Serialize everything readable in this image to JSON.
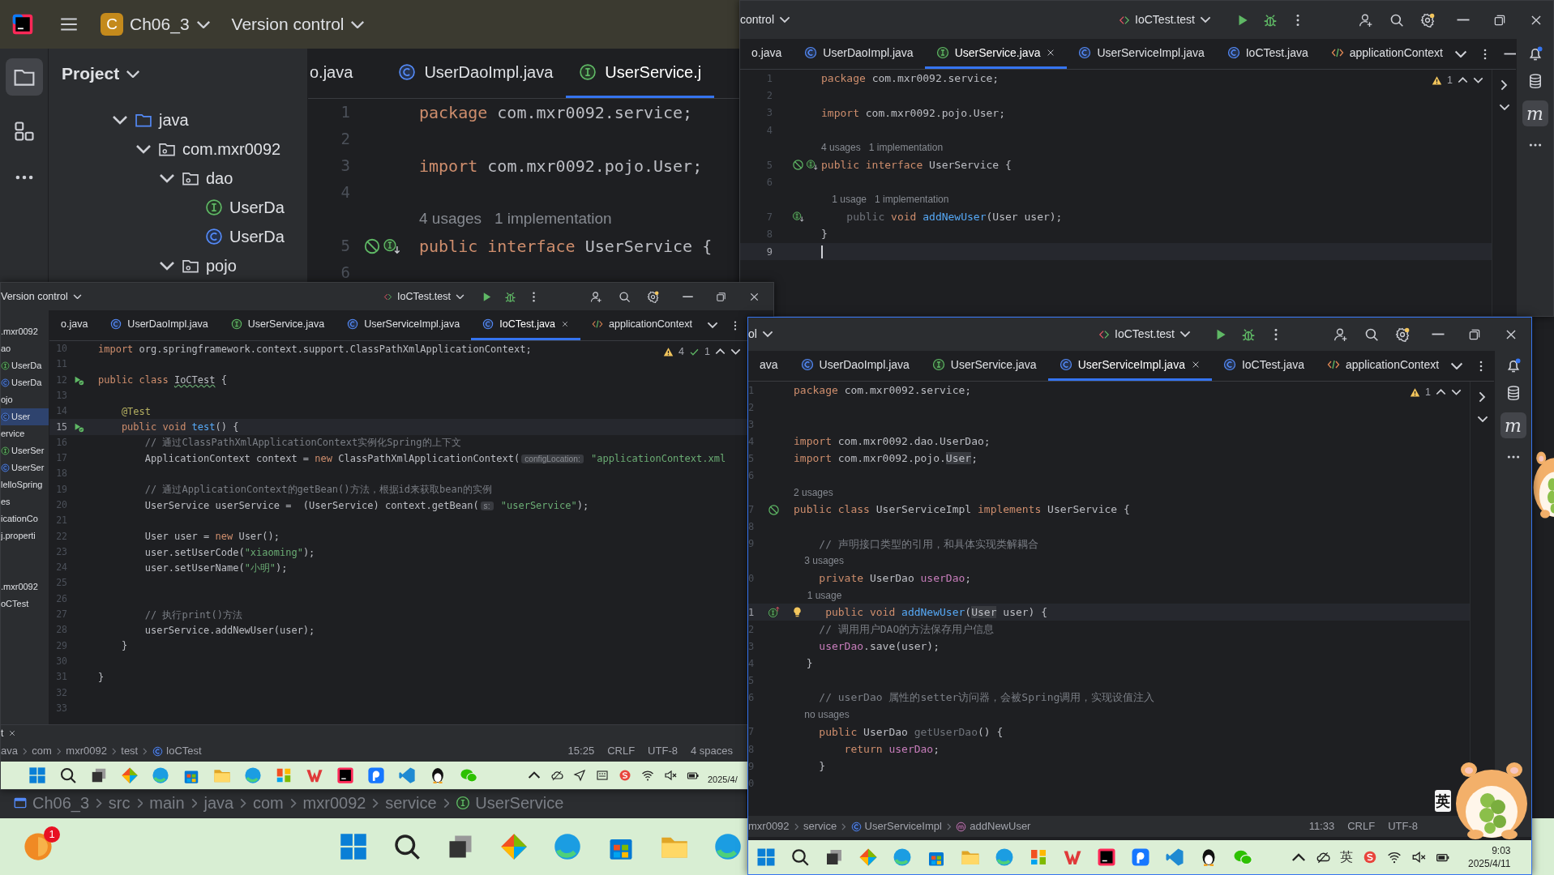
{
  "main_window": {
    "project_initial": "C",
    "project_name": "Ch06_3",
    "vcs": "Version control",
    "panel_title": "Project",
    "tree": [
      {
        "label": "java",
        "kind": "folder",
        "expanded": true,
        "children": [
          {
            "label": "com.mxr0092",
            "kind": "package",
            "expanded": true,
            "children": [
              {
                "label": "dao",
                "kind": "package",
                "expanded": true,
                "children": [
                  {
                    "label": "UserDa",
                    "kind": "interface"
                  },
                  {
                    "label": "UserDa",
                    "kind": "class"
                  }
                ]
              },
              {
                "label": "pojo",
                "kind": "package",
                "expanded": true
              }
            ]
          }
        ]
      }
    ],
    "tabs": [
      {
        "label": "o.java",
        "kind": "plain",
        "selected": false
      },
      {
        "label": "UserDaoImpl.java",
        "kind": "class",
        "selected": false
      },
      {
        "label": "UserService.j",
        "kind": "interface",
        "selected": true
      }
    ],
    "lines": [
      {
        "kind": "code",
        "number": "1",
        "current": false,
        "tokens": [
          {
            "kind": "keyword",
            "text": "package "
          },
          {
            "kind": "plain",
            "text": "com.mxr0092.service;"
          }
        ]
      },
      {
        "kind": "code",
        "number": "2",
        "current": false
      },
      {
        "kind": "code",
        "number": "3",
        "current": false,
        "tokens": [
          {
            "kind": "keyword",
            "text": "import "
          },
          {
            "kind": "plain",
            "text": "com.mxr0092.pojo.User;"
          }
        ]
      },
      {
        "kind": "code",
        "number": "4",
        "current": false
      },
      {
        "kind": "lens",
        "text": "4 usages   1 implementation"
      },
      {
        "kind": "code",
        "number": "5",
        "current": false,
        "tokens": [
          {
            "kind": "keyword",
            "text": "public interface "
          },
          {
            "kind": "plain",
            "text": "UserService {"
          }
        ]
      },
      {
        "kind": "code",
        "number": "6",
        "current": false
      }
    ],
    "breadcrumb": [
      {
        "label": "Ch06_3",
        "kind": "module"
      },
      {
        "label": "src",
        "kind": "plain"
      },
      {
        "label": "main",
        "kind": "plain"
      },
      {
        "label": "java",
        "kind": "plain"
      },
      {
        "label": "com",
        "kind": "plain"
      },
      {
        "label": "mxr0092",
        "kind": "plain"
      },
      {
        "label": "service",
        "kind": "plain"
      },
      {
        "label": "UserService",
        "kind": "interface"
      }
    ],
    "notification_count": "1"
  },
  "windows": [
    {
      "vcs": "control",
      "run_config": "IoCTest.test",
      "tabs": [
        {
          "label": "o.java",
          "kind": "plain",
          "selected": false
        },
        {
          "label": "UserDaoImpl.java",
          "kind": "class",
          "selected": false
        },
        {
          "label": "UserService.java",
          "kind": "interface",
          "selected": true
        },
        {
          "label": "UserServiceImpl.java",
          "kind": "class",
          "selected": false
        },
        {
          "label": "IoCTest.java",
          "kind": "class",
          "selected": false
        },
        {
          "label": "applicationContext",
          "kind": "xml",
          "selected": false
        }
      ],
      "inspection": {
        "warnings": "1"
      },
      "plugin_label": "m",
      "lines": [
        {
          "kind": "code",
          "number": "1",
          "current": false,
          "tokens": [
            {
              "kind": "keyword",
              "text": "package "
            },
            {
              "kind": "plain",
              "text": "com.mxr0092.service;"
            }
          ]
        },
        {
          "kind": "code",
          "number": "2",
          "current": false
        },
        {
          "kind": "code",
          "number": "3",
          "current": false,
          "tokens": [
            {
              "kind": "keyword",
              "text": "import "
            },
            {
              "kind": "plain",
              "text": "com.mxr0092.pojo.User;"
            }
          ]
        },
        {
          "kind": "code",
          "number": "4",
          "current": false
        },
        {
          "kind": "lens",
          "text": "4 usages   1 implementation"
        },
        {
          "kind": "code",
          "number": "5",
          "current": false,
          "tokens": [
            {
              "kind": "keyword",
              "text": "public interface "
            },
            {
              "kind": "plain",
              "text": "UserService {"
            }
          ]
        },
        {
          "kind": "code",
          "number": "6",
          "current": false
        },
        {
          "kind": "lens",
          "text": "    1 usage   1 implementation"
        },
        {
          "kind": "code",
          "number": "7",
          "current": false,
          "tokens": [
            {
              "kind": "muted",
              "text": "    public "
            },
            {
              "kind": "keyword",
              "text": "void "
            },
            {
              "kind": "method",
              "text": "addNewUser"
            },
            {
              "kind": "plain",
              "text": "(User user);"
            }
          ]
        },
        {
          "kind": "code",
          "number": "8",
          "current": false,
          "tokens": [
            {
              "kind": "plain",
              "text": "}"
            }
          ]
        },
        {
          "kind": "code",
          "number": "9",
          "current": true
        }
      ]
    },
    {
      "vcs": "Version control",
      "run_config": "IoCTest.test",
      "tabs": [
        {
          "label": "o.java",
          "kind": "plain",
          "selected": false
        },
        {
          "label": "UserDaoImpl.java",
          "kind": "class",
          "selected": false
        },
        {
          "label": "UserService.java",
          "kind": "interface",
          "selected": false
        },
        {
          "label": "UserServiceImpl.java",
          "kind": "class",
          "selected": false
        },
        {
          "label": "IoCTest.java",
          "kind": "class",
          "selected": true
        },
        {
          "label": "applicationContext",
          "kind": "xml",
          "selected": false
        }
      ],
      "inspection": {
        "warnings": "4",
        "checks": "1"
      },
      "project_groups": [
        [
          {
            "label": ".mxr0092",
            "kind": "plain",
            "selected": false
          },
          {
            "label": "ao",
            "kind": "plain",
            "selected": false
          },
          {
            "label": "UserDa",
            "kind": "interface",
            "selected": false
          },
          {
            "label": "UserDa",
            "kind": "class",
            "selected": false
          },
          {
            "label": "ojo",
            "kind": "plain",
            "selected": false
          },
          {
            "label": "User",
            "kind": "class",
            "selected": true
          },
          {
            "label": "ervice",
            "kind": "plain",
            "selected": false
          },
          {
            "label": "UserSer",
            "kind": "interface",
            "selected": false
          },
          {
            "label": "UserSer",
            "kind": "class",
            "selected": false
          },
          {
            "label": "lelloSpring",
            "kind": "plain",
            "selected": false
          },
          {
            "label": "es",
            "kind": "plain",
            "selected": false
          },
          {
            "label": "icationCo",
            "kind": "plain",
            "selected": false
          },
          {
            "label": "j.properti",
            "kind": "plain",
            "selected": false
          }
        ],
        [
          {
            "label": ".mxr0092",
            "kind": "plain",
            "selected": false
          },
          {
            "label": "oCTest",
            "kind": "plain",
            "selected": false
          }
        ]
      ],
      "lines": [
        {
          "kind": "code",
          "number": "10",
          "current": false,
          "tokens": [
            {
              "kind": "keyword",
              "text": "import "
            },
            {
              "kind": "plain",
              "text": "org.springframework.context.support.ClassPathXmlApplicationContext;"
            }
          ]
        },
        {
          "kind": "code",
          "number": "11",
          "current": false
        },
        {
          "kind": "code",
          "number": "12",
          "current": false,
          "tokens": [
            {
              "kind": "keyword",
              "text": "public class "
            },
            {
              "kind": "typo",
              "text": "IoCTest"
            },
            {
              "kind": "plain",
              "text": " {"
            }
          ]
        },
        {
          "kind": "code",
          "number": "13",
          "current": false
        },
        {
          "kind": "code",
          "number": "14",
          "current": false,
          "tokens": [
            {
              "kind": "annotation",
              "text": "    @Test"
            }
          ]
        },
        {
          "kind": "code",
          "number": "15",
          "current": true,
          "tokens": [
            {
              "kind": "keyword",
              "text": "    public void "
            },
            {
              "kind": "method",
              "text": "test"
            },
            {
              "kind": "plain",
              "text": "() {"
            }
          ]
        },
        {
          "kind": "code",
          "number": "16",
          "current": false,
          "tokens": [
            {
              "kind": "comment",
              "text": "        // 通过ClassPathXmlApplicationContext实例化Spring的上下文"
            }
          ]
        },
        {
          "kind": "code",
          "number": "17",
          "current": false,
          "tokens": [
            {
              "kind": "plain",
              "text": "        ApplicationContext context = "
            },
            {
              "kind": "keyword",
              "text": "new "
            },
            {
              "kind": "plain",
              "text": "ClassPathXmlApplicationContext("
            },
            {
              "kind": "hint",
              "text": "configLocation:"
            },
            {
              "kind": "string",
              "text": " \"applicationContext.xml"
            }
          ]
        },
        {
          "kind": "code",
          "number": "18",
          "current": false
        },
        {
          "kind": "code",
          "number": "19",
          "current": false,
          "tokens": [
            {
              "kind": "comment",
              "text": "        // 通过ApplicationContext的getBean()方法，根据id来获取bean的实例"
            }
          ]
        },
        {
          "kind": "code",
          "number": "20",
          "current": false,
          "tokens": [
            {
              "kind": "plain",
              "text": "        UserService userService =  (UserService) context.getBean("
            },
            {
              "kind": "hint",
              "text": "s:"
            },
            {
              "kind": "string",
              "text": " \"userService\""
            },
            {
              "kind": "plain",
              "text": ");"
            }
          ]
        },
        {
          "kind": "code",
          "number": "21",
          "current": false
        },
        {
          "kind": "code",
          "number": "22",
          "current": false,
          "tokens": [
            {
              "kind": "plain",
              "text": "        User user = "
            },
            {
              "kind": "keyword",
              "text": "new "
            },
            {
              "kind": "plain",
              "text": "User();"
            }
          ]
        },
        {
          "kind": "code",
          "number": "23",
          "current": false,
          "tokens": [
            {
              "kind": "plain",
              "text": "        user.setUserCode("
            },
            {
              "kind": "string",
              "text": "\"xiaoming\""
            },
            {
              "kind": "plain",
              "text": ");"
            }
          ]
        },
        {
          "kind": "code",
          "number": "24",
          "current": false,
          "tokens": [
            {
              "kind": "plain",
              "text": "        user.setUserName("
            },
            {
              "kind": "string",
              "text": "\"小明\""
            },
            {
              "kind": "plain",
              "text": ");"
            }
          ]
        },
        {
          "kind": "code",
          "number": "25",
          "current": false
        },
        {
          "kind": "code",
          "number": "26",
          "current": false
        },
        {
          "kind": "code",
          "number": "27",
          "current": false,
          "tokens": [
            {
              "kind": "comment",
              "text": "        // 执行print()方法"
            }
          ]
        },
        {
          "kind": "code",
          "number": "28",
          "current": false,
          "tokens": [
            {
              "kind": "plain",
              "text": "        userService.addNewUser(user);"
            }
          ]
        },
        {
          "kind": "code",
          "number": "29",
          "current": false,
          "tokens": [
            {
              "kind": "plain",
              "text": "    }"
            }
          ]
        },
        {
          "kind": "code",
          "number": "30",
          "current": false
        },
        {
          "kind": "code",
          "number": "31",
          "current": false,
          "tokens": [
            {
              "kind": "plain",
              "text": "}"
            }
          ]
        },
        {
          "kind": "code",
          "number": "32",
          "current": false
        },
        {
          "kind": "code",
          "number": "33",
          "current": false
        }
      ],
      "tool_tab": "t",
      "breadcrumb": [
        {
          "label": "ava",
          "kind": "plain"
        },
        {
          "label": "com",
          "kind": "plain"
        },
        {
          "label": "mxr0092",
          "kind": "plain"
        },
        {
          "label": "test",
          "kind": "plain"
        },
        {
          "label": "IoCTest",
          "kind": "class"
        }
      ],
      "status": [
        "15:25",
        "CRLF",
        "UTF-8",
        "4 spaces"
      ],
      "taskbar": {
        "clock": [
          "2025/4/"
        ]
      }
    },
    {
      "vcs": "ol",
      "run_config": "IoCTest.test",
      "tabs": [
        {
          "label": "ava",
          "kind": "plain",
          "selected": false
        },
        {
          "label": "UserDaoImpl.java",
          "kind": "class",
          "selected": false
        },
        {
          "label": "UserService.java",
          "kind": "interface",
          "selected": false
        },
        {
          "label": "UserServiceImpl.java",
          "kind": "class",
          "selected": true
        },
        {
          "label": "IoCTest.java",
          "kind": "class",
          "selected": false
        },
        {
          "label": "applicationContext",
          "kind": "xml",
          "selected": false
        }
      ],
      "inspection": {
        "warnings": "1"
      },
      "plugin_label": "m",
      "lines": [
        {
          "kind": "code",
          "number": "1",
          "current": false,
          "tokens": [
            {
              "kind": "keyword",
              "text": "package "
            },
            {
              "kind": "plain",
              "text": "com.mxr0092.service;"
            }
          ]
        },
        {
          "kind": "code",
          "number": "2",
          "current": false
        },
        {
          "kind": "code",
          "number": "3",
          "current": false
        },
        {
          "kind": "code",
          "number": "4",
          "current": false,
          "tokens": [
            {
              "kind": "keyword",
              "text": "import "
            },
            {
              "kind": "plain",
              "text": "com.mxr0092.dao.UserDao;"
            }
          ]
        },
        {
          "kind": "code",
          "number": "5",
          "current": false,
          "tokens": [
            {
              "kind": "keyword",
              "text": "import "
            },
            {
              "kind": "plain",
              "text": "com.mxr0092.pojo."
            },
            {
              "kind": "ref",
              "text": "User"
            },
            {
              "kind": "plain",
              "text": ";"
            }
          ]
        },
        {
          "kind": "code",
          "number": "6",
          "current": false
        },
        {
          "kind": "lens",
          "text": "2 usages"
        },
        {
          "kind": "code",
          "number": "7",
          "current": false,
          "tokens": [
            {
              "kind": "keyword",
              "text": "public class "
            },
            {
              "kind": "plain",
              "text": "UserServiceImpl "
            },
            {
              "kind": "keyword",
              "text": "implements "
            },
            {
              "kind": "plain",
              "text": "UserService {"
            }
          ]
        },
        {
          "kind": "code",
          "number": "8",
          "current": false
        },
        {
          "kind": "code",
          "number": "9",
          "current": false,
          "tokens": [
            {
              "kind": "comment",
              "text": "    // 声明接口类型的引用，和具体实现类解耦合"
            }
          ]
        },
        {
          "kind": "lens",
          "text": "    3 usages"
        },
        {
          "kind": "code",
          "number": "0",
          "current": false,
          "tokens": [
            {
              "kind": "keyword",
              "text": "    private "
            },
            {
              "kind": "plain",
              "text": "UserDao "
            },
            {
              "kind": "field",
              "text": "userDao"
            },
            {
              "kind": "plain",
              "text": ";"
            }
          ]
        },
        {
          "kind": "lens",
          "text": "     1 usage"
        },
        {
          "kind": "code",
          "number": "1",
          "current": true,
          "tokens": [
            {
              "kind": "keyword",
              "text": "     public void "
            },
            {
              "kind": "method",
              "text": "addNewUser"
            },
            {
              "kind": "plain",
              "text": "("
            },
            {
              "kind": "ref",
              "text": "User"
            },
            {
              "kind": "plain",
              "text": " user) {"
            }
          ]
        },
        {
          "kind": "code",
          "number": "2",
          "current": false,
          "tokens": [
            {
              "kind": "comment",
              "text": "    // 调用用户DAO的方法保存用户信息"
            }
          ]
        },
        {
          "kind": "code",
          "number": "3",
          "current": false,
          "tokens": [
            {
              "kind": "field",
              "text": "    userDao"
            },
            {
              "kind": "plain",
              "text": ".save(user);"
            }
          ]
        },
        {
          "kind": "code",
          "number": "4",
          "current": false,
          "tokens": [
            {
              "kind": "plain",
              "text": "  }"
            }
          ]
        },
        {
          "kind": "code",
          "number": "5",
          "current": false
        },
        {
          "kind": "code",
          "number": "6",
          "current": false,
          "tokens": [
            {
              "kind": "comment",
              "text": "    // userDao 属性的setter访问器，会被Spring调用，实现设值注入"
            }
          ]
        },
        {
          "kind": "lens",
          "text": "    no usages"
        },
        {
          "kind": "code",
          "number": "7",
          "current": false,
          "tokens": [
            {
              "kind": "keyword",
              "text": "    public "
            },
            {
              "kind": "plain",
              "text": "UserDao "
            },
            {
              "kind": "muted",
              "text": "getUserDao"
            },
            {
              "kind": "plain",
              "text": "() {"
            }
          ]
        },
        {
          "kind": "code",
          "number": "8",
          "current": false,
          "tokens": [
            {
              "kind": "keyword",
              "text": "        return "
            },
            {
              "kind": "field",
              "text": "userDao"
            },
            {
              "kind": "plain",
              "text": ";"
            }
          ]
        },
        {
          "kind": "code",
          "number": "9",
          "current": false,
          "tokens": [
            {
              "kind": "plain",
              "text": "    }"
            }
          ]
        },
        {
          "kind": "code",
          "number": "0",
          "current": false
        }
      ],
      "breadcrumb": [
        {
          "label": "mxr0092",
          "kind": "plain"
        },
        {
          "label": "service",
          "kind": "plain"
        },
        {
          "label": "UserServiceImpl",
          "kind": "class"
        },
        {
          "label": "addNewUser",
          "kind": "method"
        }
      ],
      "status": [
        "11:33",
        "CRLF",
        "UTF-8"
      ],
      "ime_label": "英",
      "taskbar": {
        "ime": "英",
        "clock": [
          "9:03",
          "2025/4/11"
        ]
      }
    }
  ]
}
